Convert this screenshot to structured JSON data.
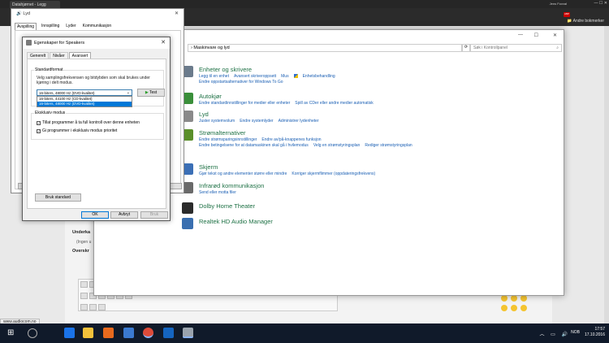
{
  "browser": {
    "tab_title": "Datahjørnet - Legg",
    "user": "Jens Fovval",
    "other_bookmarks": "Andre bokmerker",
    "ext_badge": "ABP",
    "status_url": "www.audiocom.no"
  },
  "forum": {
    "label1": "Underka",
    "sub1": "(Ingen u",
    "label2": "Overskr"
  },
  "sound_window": {
    "title": "Lyd",
    "close": "✕",
    "tabs": [
      "Avspilling",
      "Innspilling",
      "Lyder",
      "Kommunikasjon"
    ]
  },
  "speakers_dialog": {
    "title": "Egenskaper for Speakers",
    "close": "✕",
    "tabs": [
      "Generelt",
      "Nivåer",
      "Avansert"
    ],
    "active_tab": "Avansert",
    "default_format_group": "Standardformat",
    "default_format_desc": "Velg samplingsfrekvensen og bitdybden som skal brukes under kjøring i delt modus.",
    "format_selected": "16-biters, 48000 Hz (DVD-kvalitet)",
    "format_options": [
      "16-biters, 44100 Hz (CD-kvalitet)",
      "16-biters, 48000 Hz (DVD-kvalitet)"
    ],
    "test_button": "Test",
    "exclusive_group": "Eksklusiv modus",
    "exclusive_opt1": "Tillat programmer å ta full kontroll over denne enheten",
    "exclusive_opt2": "Gi programmer i eksklusiv modus prioritet",
    "restore_default": "Bruk standard",
    "ok": "OK",
    "cancel": "Avbryt",
    "apply": "Bruk"
  },
  "control_panel": {
    "address": "Maskinvare og lyd",
    "search_placeholder": "Søk i Kontrollpanel",
    "categories": [
      {
        "title": "Enheter og skrivere",
        "links": [
          "Legg til en enhet",
          "Avansert skriveroppsett",
          "Mus",
          "Enhetsbehandling",
          "Endre oppstartsalternativer for Windows To Go"
        ],
        "color": "#6b7b8c"
      },
      {
        "title": "Autokjør",
        "links": [
          "Endre standardinnstillinger for medier eller enheter",
          "Spill av CDer eller andre medier automatisk"
        ],
        "color": "#3a8f3a"
      },
      {
        "title": "Lyd",
        "links": [
          "Juster systemvolum",
          "Endre systemlyder",
          "Administrer lydenheter"
        ],
        "color": "#8a8a8a"
      },
      {
        "title": "Strømalternativer",
        "links": [
          "Endre strømsparingsinnstillinger",
          "Endre av/på-knappenes funksjon",
          "Endre betingelsene for at datamaskinen skal gå i hvilemodus",
          "Velg en strømstyringsplan",
          "Rediger strømstyringsplan"
        ],
        "color": "#5a8f2a"
      },
      {
        "title": "Skjerm",
        "links": [
          "Gjør tekst og andre elementer større eller mindre",
          "Korriger skjermflimmer (oppdateringsfrekvens)"
        ],
        "color": "#3b6fb6"
      },
      {
        "title": "Infrarød kommunikasjon",
        "links": [
          "Send eller motta filer"
        ],
        "color": "#6a6a6a"
      },
      {
        "title": "Dolby Home Theater",
        "links": [],
        "color": "#2b2b2b"
      },
      {
        "title": "Realtek HD Audio Manager",
        "links": [],
        "color": "#3a6fb0"
      }
    ]
  },
  "taskbar": {
    "time": "17:57",
    "date": "17.10.2016",
    "lang": "NOB",
    "icons": [
      {
        "name": "edge-icon",
        "color": "#1a73e8"
      },
      {
        "name": "file-explorer-icon",
        "color": "#f2c13b"
      },
      {
        "name": "audio-app-icon",
        "color": "#e86a1e"
      },
      {
        "name": "store-icon",
        "color": "#3b7ad0"
      },
      {
        "name": "chrome-icon",
        "color": "#dd4b39"
      },
      {
        "name": "outlook-icon",
        "color": "#1565c0"
      },
      {
        "name": "speaker-app-icon",
        "color": "#9aa3ad"
      }
    ]
  }
}
